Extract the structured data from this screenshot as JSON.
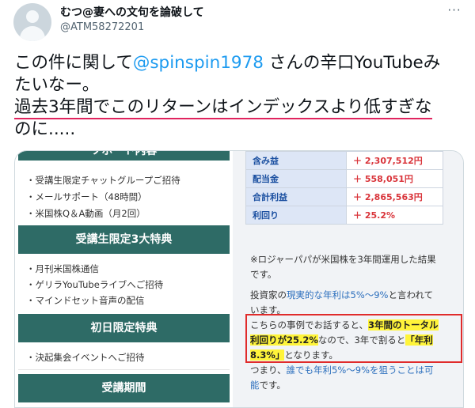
{
  "author": {
    "name": "むつ@妻への文句を論破して",
    "handle": "@ATM58272201"
  },
  "tweet": {
    "line1_before": "この件に関して",
    "mention": "@spinspin1978",
    "line1_after": " さんの辛口YouTubeみ",
    "line2": "たいなー。",
    "line3": "過去3年間でこのリターンはインデックスより低すぎな",
    "line4": "のに....."
  },
  "image": {
    "left": {
      "cut_top": "ソポート内容",
      "items1": [
        "・受講生限定チャットグループご招待",
        "・メールサポート（48時間）",
        "・米国株Q＆A動画（月2回）"
      ],
      "band2": "受講生限定3大特典",
      "items2": [
        "・月刊米国株通信",
        "・ゲリラYouTubeライブへご招待",
        "・マインドセット音声の配信"
      ],
      "band3": "初日限定特典",
      "items3": [
        "・決起集会イベントへご招待"
      ],
      "band4": "受講期間"
    },
    "right": {
      "table": [
        {
          "label": "含み益",
          "value": "＋ 2,307,512円"
        },
        {
          "label": "配当金",
          "value": "＋ 558,051円"
        },
        {
          "label": "合計利益",
          "value": "＋ 2,865,563円"
        },
        {
          "label": "利回り",
          "value": "＋ 25.2%"
        }
      ],
      "p1": [
        "※ロジャーパパが米国株を3年間運用した結果",
        "です。"
      ],
      "p2_a": "投資家の",
      "p2_blue": "現実的な年利は5%〜9%",
      "p2_b": "と言われて",
      "p2_c": "います。",
      "p3_a": "こちらの事例でお話すると、",
      "p3_hl1": "3年間のトータル",
      "p3_hl2": "利回りが25.2%",
      "p3_b": "なので、3年で割ると",
      "p3_hl3": "「年利",
      "p3_hl4": "8.3%」",
      "p3_c": "となります。",
      "p4_a": "つまり、",
      "p4_blue": "誰でも年利5%〜9%を狙うことは可",
      "p4_blue2": "能",
      "p4_b": "です。"
    }
  },
  "icons": {
    "more": "more-icon"
  }
}
